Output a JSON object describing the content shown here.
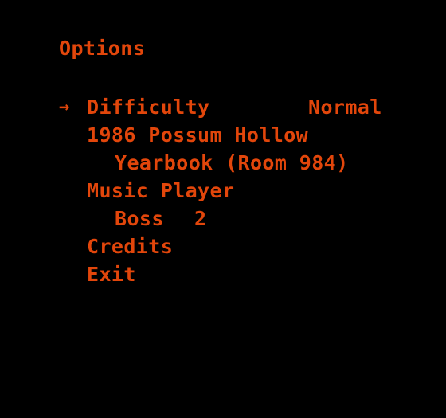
{
  "screen": {
    "background_color": "#000000",
    "text_color": "#e2460b"
  },
  "title": "Options",
  "cursor": {
    "glyph": "→",
    "selected_index": 0
  },
  "menu": {
    "items": [
      {
        "label": "Difficulty",
        "value": "Normal",
        "indent": 0,
        "value_column": "far",
        "selected": true
      },
      {
        "label": "1986 Possum Hollow",
        "value": "",
        "indent": 0,
        "value_column": "far",
        "selected": false
      },
      {
        "label": "Yearbook (Room 984)",
        "value": "",
        "indent": 1,
        "value_column": "far",
        "selected": false
      },
      {
        "label": "Music Player",
        "value": "",
        "indent": 0,
        "value_column": "far",
        "selected": false
      },
      {
        "label": "Boss",
        "value": "2",
        "indent": 1,
        "value_column": "near",
        "selected": false
      },
      {
        "label": "Credits",
        "value": "",
        "indent": 0,
        "value_column": "far",
        "selected": false
      },
      {
        "label": "Exit",
        "value": "",
        "indent": 0,
        "value_column": "far",
        "selected": false
      }
    ]
  }
}
